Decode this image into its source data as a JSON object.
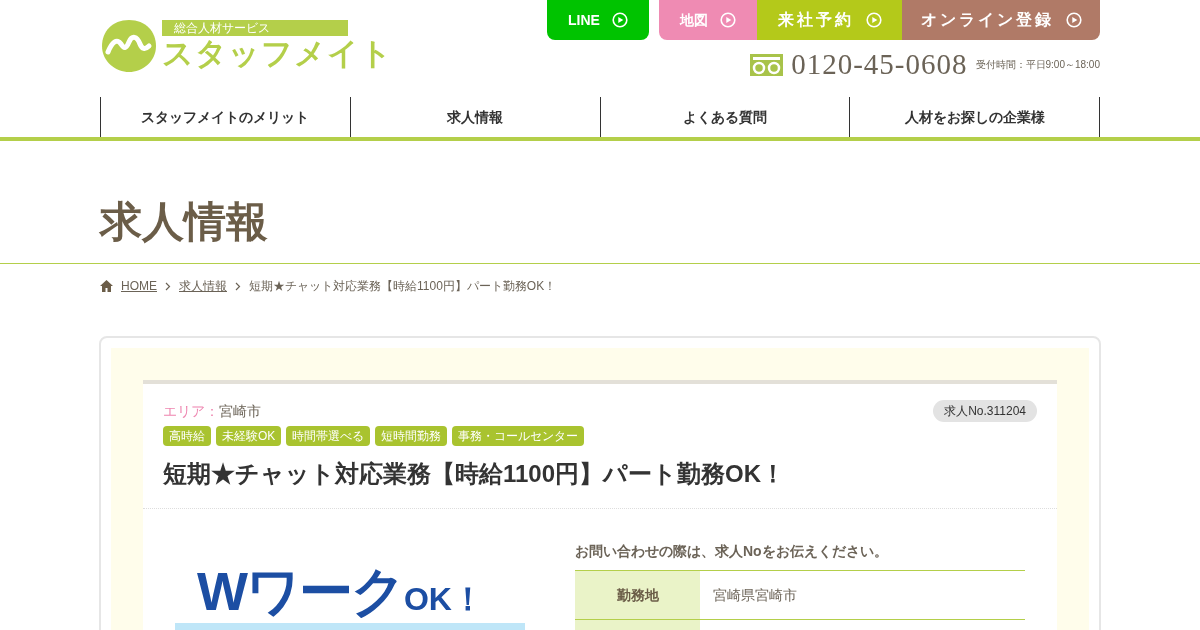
{
  "logo": {
    "tagline": "総合人材サービス",
    "name": "スタッフメイト"
  },
  "header_buttons": [
    {
      "label": "LINE",
      "kind": "line"
    },
    {
      "label": "地図",
      "kind": "map"
    },
    {
      "label": "来社予約",
      "kind": "visit"
    },
    {
      "label": "オンライン登録",
      "kind": "online"
    }
  ],
  "phone": {
    "number": "0120-45-0608",
    "hours": "受付時間：平日9:00～18:00"
  },
  "nav": [
    {
      "label": "スタッフメイトのメリット",
      "selected": false
    },
    {
      "label": "求人情報",
      "selected": false
    },
    {
      "label": "よくある質問",
      "selected": false
    },
    {
      "label": "人材をお探しの企業様",
      "selected": false
    }
  ],
  "page_title": "求人情報",
  "breadcrumb": [
    {
      "label": "HOME",
      "link": true
    },
    {
      "label": "求人情報",
      "link": true
    },
    {
      "label": "短期★チャット対応業務【時給1100円】パート勤務OK！",
      "link": false
    }
  ],
  "job": {
    "area_label": "エリア：",
    "area": "宮崎市",
    "number": "求人No.311204",
    "tags": [
      "高時給",
      "未経験OK",
      "時間帯選べる",
      "短時間勤務",
      "事務・コールセンター"
    ],
    "title": "短期★チャット対応業務【時給1100円】パート勤務OK！",
    "banner": {
      "headline": "Wワーク",
      "suffix": "OK！"
    },
    "notice": "お問い合わせの際は、求人Noをお伝えください。",
    "details": [
      {
        "label": "勤務地",
        "value": "宮崎県宮崎市"
      }
    ]
  }
}
